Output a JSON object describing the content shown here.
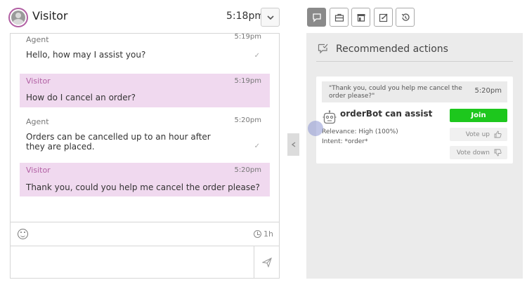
{
  "chat": {
    "visitor_name": "Visitor",
    "time": "5:18pm",
    "messages": [
      {
        "sender": "Agent",
        "time": "5:19pm",
        "text": "Hello, how may I assist you?",
        "role": "agent"
      },
      {
        "sender": "Visitor",
        "time": "5:19pm",
        "text": "How do I cancel an order?",
        "role": "visitor"
      },
      {
        "sender": "Agent",
        "time": "5:20pm",
        "text": "Orders can be cancelled up to an hour after they are placed.",
        "role": "agent"
      },
      {
        "sender": "Visitor",
        "time": "5:20pm",
        "text": "Thank you, could you help me cancel the order please?",
        "role": "visitor"
      }
    ],
    "duration": "1h",
    "icons": {
      "emoji": "smiley-icon",
      "clock": "clock-icon",
      "send": "send-icon",
      "dropdown": "chevron-down-icon",
      "read": "checkmark-icon"
    }
  },
  "toolbar": {
    "tabs": [
      {
        "name": "chat-bubble-icon",
        "active": true
      },
      {
        "name": "briefcase-icon",
        "active": false
      },
      {
        "name": "store-icon",
        "active": false
      },
      {
        "name": "edit-icon",
        "active": false
      },
      {
        "name": "history-icon",
        "active": false
      }
    ]
  },
  "recommended": {
    "title": "Recommended actions",
    "quote": "\"Thank you, could you help me cancel the order please?\"",
    "quote_time": "5:20pm",
    "bot_title": "orderBot can assist",
    "relevance": "Relevance: High (100%)",
    "intent": "Intent: *order*",
    "join_label": "Join",
    "vote_up_label": "Vote up",
    "vote_down_label": "Vote down"
  },
  "colors": {
    "visitor_bubble": "#f0d9ef",
    "visitor_accent": "#b15fa3",
    "join_button": "#1dc71d",
    "right_panel": "#ebebeb"
  }
}
